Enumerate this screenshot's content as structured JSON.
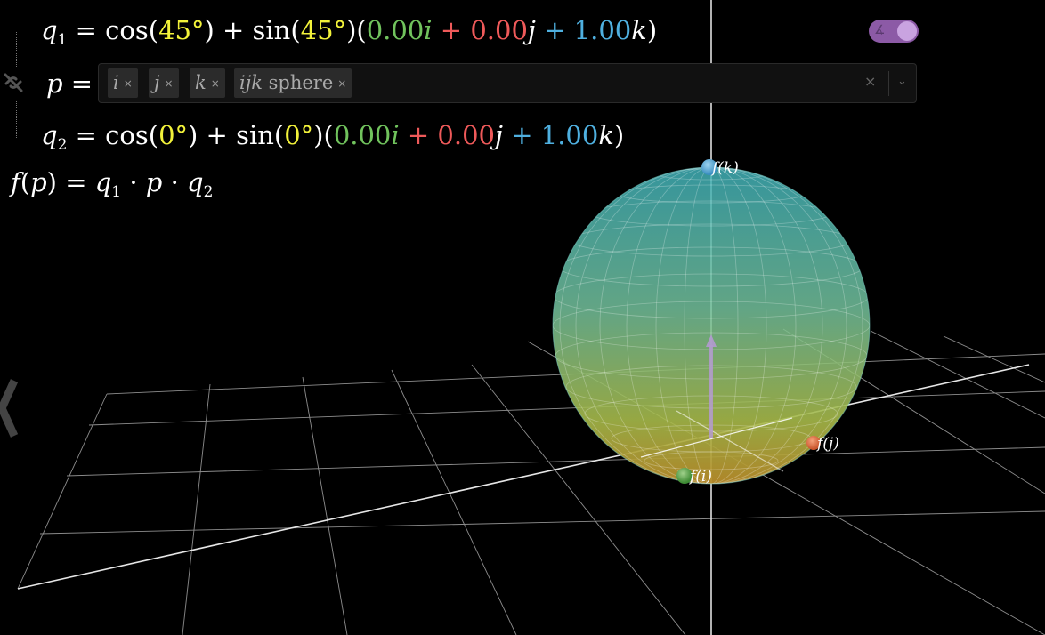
{
  "q1": {
    "lhs": "q",
    "lhs_sub": "1",
    "eq": "=",
    "cos": "cos(",
    "angle1": "45°",
    "close_plus_sin": ") + sin(",
    "angle2": "45°",
    "open": ")(",
    "i_coef": "0.00",
    "i": "i",
    "plus1": " + ",
    "j_coef": "0.00",
    "j": "j",
    "plus2": " + ",
    "k_coef": "1.00",
    "k": "k",
    "close": ")"
  },
  "p": {
    "label": "p",
    "eq": "=",
    "chips": [
      {
        "label": "i",
        "remove": "×"
      },
      {
        "label": "j",
        "remove": "×"
      },
      {
        "label": "k",
        "remove": "×"
      },
      {
        "label_var": "ijk",
        "label_text": " sphere",
        "remove": "×"
      }
    ],
    "clear": "×",
    "dropdown_icon": "chevron-down-icon"
  },
  "q2": {
    "lhs": "q",
    "lhs_sub": "2",
    "eq": "=",
    "cos": "cos(",
    "angle1": "0°",
    "close_plus_sin": ") + sin(",
    "angle2": "0°",
    "open": ")(",
    "i_coef": "0.00",
    "i": "i",
    "plus1": " + ",
    "j_coef": "0.00",
    "j": "j",
    "plus2": " + ",
    "k_coef": "1.00",
    "k": "k",
    "close": ")"
  },
  "f": {
    "name": "f",
    "open": "(",
    "arg": "p",
    "close": ")",
    "eq": "=",
    "q1": "q",
    "q1_sub": "1",
    "dot": "·",
    "p": "p",
    "q2": "q",
    "q2_sub": "2"
  },
  "points": {
    "k": {
      "label": "f(k)",
      "color": "#4fa6d8"
    },
    "j": {
      "label": "f(j)",
      "color": "#e0653a"
    },
    "i": {
      "label": "f(i)",
      "color": "#5aa64a"
    }
  },
  "toggle": {
    "state": "on",
    "icon": "angle-icon",
    "color": "#8c5aa6"
  },
  "colors": {
    "angle": "#f2f23a",
    "i": "#71c35d",
    "j": "#ef5a5a",
    "k": "#4fb0e0"
  }
}
